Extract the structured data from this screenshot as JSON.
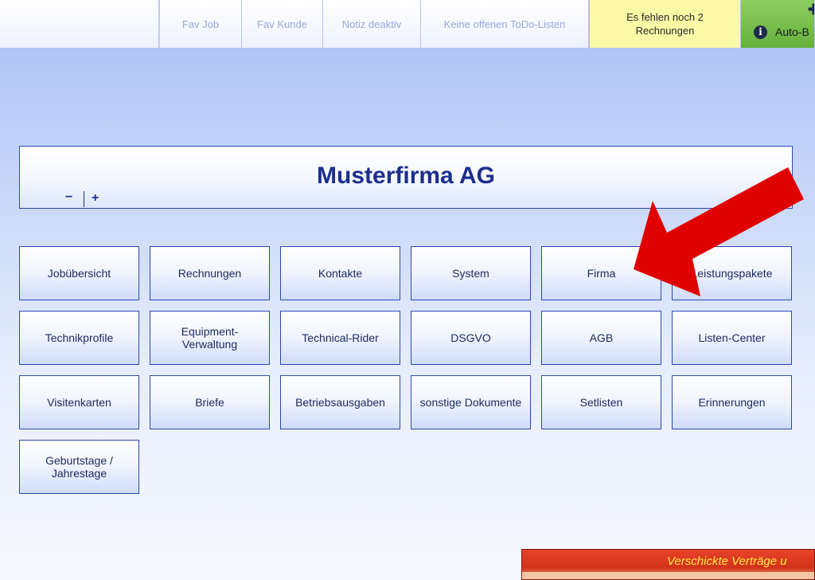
{
  "topbar": {
    "fav_job": "Fav Job",
    "fav_kunde": "Fav Kunde",
    "notiz": "Notiz deaktiv",
    "todo": "Keine offenen ToDo-Listen",
    "rechnungen_line1": "Es fehlen noch 2",
    "rechnungen_line2": "Rechnungen",
    "auto": "Auto-B",
    "info_icon": "i",
    "plus_icon": "✚"
  },
  "company": {
    "name": "Musterfirma AG",
    "zoom_minus": "−",
    "zoom_plus": "+"
  },
  "tiles": [
    "Jobübersicht",
    "Rechnungen",
    "Kontakte",
    "System",
    "Firma",
    "Leistungspakete",
    "Technikprofile",
    "Equipment-\nVerwaltung",
    "Technical-Rider",
    "DSGVO",
    "AGB",
    "Listen-Center",
    "Visitenkarten",
    "Briefe",
    "Betriebsausgaben",
    "sonstige Dokumente",
    "Setlisten",
    "Erinnerungen",
    "Geburtstage /\nJahrestage"
  ],
  "bottom_banner": {
    "text": "Verschickte Verträge u"
  },
  "colors": {
    "accent": "#1c2f8f",
    "arrow": "#e00000",
    "warning_yellow": "#fbf8a6",
    "auto_green": "#6fb845"
  }
}
